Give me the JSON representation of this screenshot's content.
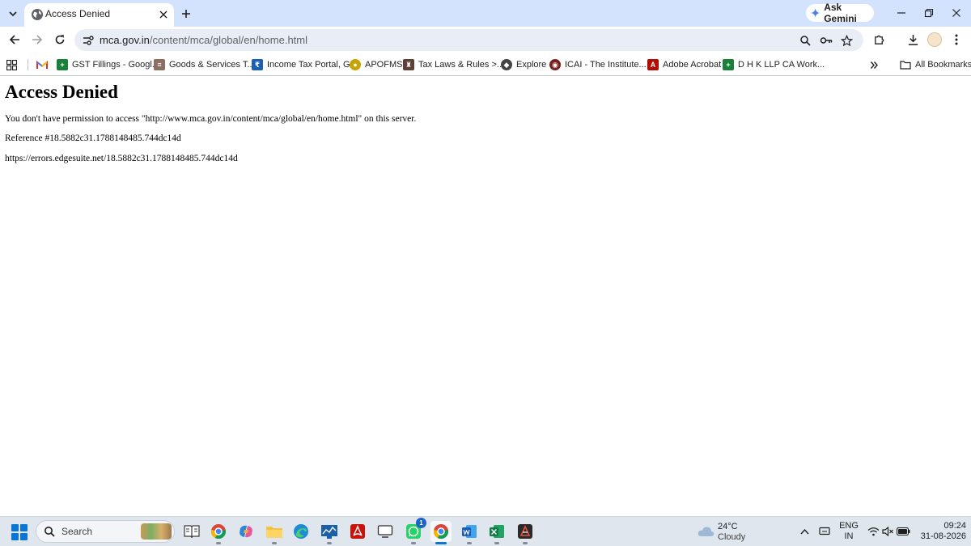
{
  "browser": {
    "tab": {
      "title": "Access Denied"
    },
    "gemini_label": "Ask Gemini",
    "address": {
      "host": "mca.gov.in",
      "path": "/content/mca/global/en/home.html"
    },
    "bookmarks": [
      {
        "label": "GST Fillings - Googl...",
        "icon": "google-sheets-icon",
        "color": "#188038"
      },
      {
        "label": "Goods & Services T...",
        "icon": "gst-emblem-icon",
        "color": "#8d6e63"
      },
      {
        "label": "Income Tax Portal, G...",
        "icon": "income-tax-icon",
        "color": "#1a5fb4"
      },
      {
        "label": "APOFMS",
        "icon": "apofms-icon",
        "color": "#c8a400"
      },
      {
        "label": "Tax Laws & Rules >...",
        "icon": "emblem-icon",
        "color": "#5d4037"
      },
      {
        "label": "Explore",
        "icon": "explore-icon",
        "color": "#444444"
      },
      {
        "label": "ICAI - The Institute...",
        "icon": "icai-icon",
        "color": "#7b1f1f"
      },
      {
        "label": "Adobe Acrobat",
        "icon": "adobe-acrobat-icon",
        "color": "#b30b00"
      },
      {
        "label": "D H K LLP CA Work...",
        "icon": "google-sheets-icon",
        "color": "#188038"
      }
    ],
    "all_bookmarks_label": "All Bookmarks"
  },
  "page": {
    "heading": "Access Denied",
    "message": "You don't have permission to access \"http://www.mca.gov.in/content/mca/global/en/home.html\" on this server.",
    "reference": "Reference #18.5882c31.1788148485.744dc14d",
    "error_url": "https://errors.edgesuite.net/18.5882c31.1788148485.744dc14d"
  },
  "taskbar": {
    "search_placeholder": "Search",
    "whatsapp_badge": "1",
    "weather": {
      "temp": "24°C",
      "condition": "Cloudy"
    },
    "language": {
      "line1": "ENG",
      "line2": "IN"
    },
    "clock": {
      "time": "09:24",
      "date": "31-08-2026"
    }
  },
  "colors": {
    "tabstrip": "#d3e3fd",
    "omnibox": "#e9eef6",
    "taskbar": "#dfe6ee",
    "accent": "#0a74d8"
  }
}
